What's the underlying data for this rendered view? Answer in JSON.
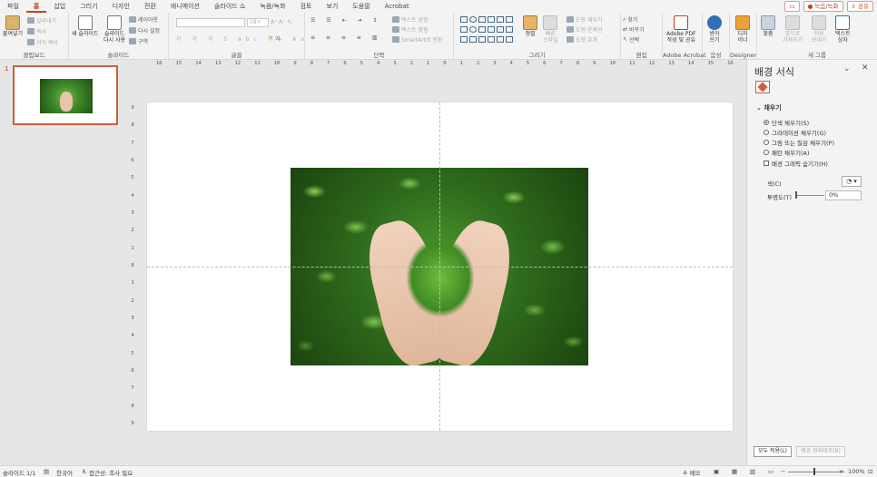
{
  "menu": {
    "tabs": [
      "파일",
      "홈",
      "삽입",
      "그리기",
      "디자인",
      "전환",
      "애니메이션",
      "슬라이드 쇼",
      "녹음/녹화",
      "검토",
      "보기",
      "도움말",
      "Acrobat"
    ],
    "active_index": 1,
    "comment_icon": "comment-icon",
    "record_label": "녹음/녹화",
    "share_label": "공유"
  },
  "ribbon": {
    "clipboard": {
      "label": "클립보드",
      "paste": "붙여넣기",
      "cut": "잘라내기",
      "copy": "복사",
      "format_painter": "서식 복사"
    },
    "slides": {
      "label": "슬라이드",
      "new_slide": "새 슬라이드",
      "reuse_slide_1": "슬라이드",
      "reuse_slide_2": "다시 사용",
      "layout": "레이아웃",
      "reset": "다시 설정",
      "section": "구역"
    },
    "font": {
      "label": "글꼴",
      "font_name": "",
      "font_size": "18+"
    },
    "paragraph": {
      "label": "단락",
      "text_direction": "텍스트 방향",
      "align_text": "텍스트 맞춤",
      "smartart": "SmartArt로 변환"
    },
    "drawing": {
      "label": "그리기",
      "arrange": "정렬",
      "quick_styles_1": "빠른",
      "quick_styles_2": "스타일",
      "shape_fill": "도형 채우기",
      "shape_outline": "도형 윤곽선",
      "shape_effects": "도형 효과"
    },
    "editing": {
      "label": "편집",
      "find": "찾기",
      "replace": "바꾸기",
      "select": "선택"
    },
    "acrobat": {
      "label": "Adobe Acrobat",
      "btn_1": "Adobe PDF",
      "btn_2": "작성 및 공유"
    },
    "voice": {
      "label": "음성",
      "dictate_1": "받아",
      "dictate_2": "쓰기"
    },
    "designer": {
      "label": "Designer",
      "btn_1": "디자",
      "btn_2": "이너"
    },
    "newgroup": {
      "label": "새 그룹",
      "align": "맞춤",
      "send_back_1": "앞으로",
      "send_back_2": "가져오기",
      "bring_front_1": "뒤로",
      "bring_front_2": "보내기",
      "text_box_1": "텍스트",
      "text_box_2": "상자"
    }
  },
  "thumbnails": {
    "slide_number": "1"
  },
  "ruler": {
    "h_ticks": [
      "16",
      "15",
      "14",
      "13",
      "12",
      "11",
      "10",
      "9",
      "8",
      "7",
      "6",
      "5",
      "4",
      "3",
      "2",
      "1",
      "0",
      "1",
      "2",
      "3",
      "4",
      "5",
      "6",
      "7",
      "8",
      "9",
      "10",
      "11",
      "12",
      "13",
      "14",
      "15",
      "16"
    ],
    "v_ticks": [
      "9",
      "8",
      "7",
      "6",
      "5",
      "4",
      "3",
      "2",
      "1",
      "0",
      "1",
      "2",
      "3",
      "4",
      "5",
      "6",
      "7",
      "8",
      "9"
    ]
  },
  "panel": {
    "title": "배경 서식",
    "section": "채우기",
    "fill_options": [
      "단색 채우기(S)",
      "그라데이션 채우기(G)",
      "그림 또는 질감 채우기(P)",
      "패턴 채우기(A)"
    ],
    "selected_fill_index": 0,
    "hide_graphics": "배경 그래픽 숨기기(H)",
    "color_label": "색(C)",
    "transparency_label": "투명도(T)",
    "transparency_value": "0%",
    "apply_all": "모두 적용(L)",
    "reset_background": "배경 원래대로(B)"
  },
  "status": {
    "slide": "슬라이드 1/1",
    "language": "한국어",
    "accessibility": "접근성: 조사 필요",
    "notes": "메모",
    "zoom": "100%"
  },
  "colors": {
    "accent": "#c43e1c",
    "selection": "#c9603f"
  }
}
